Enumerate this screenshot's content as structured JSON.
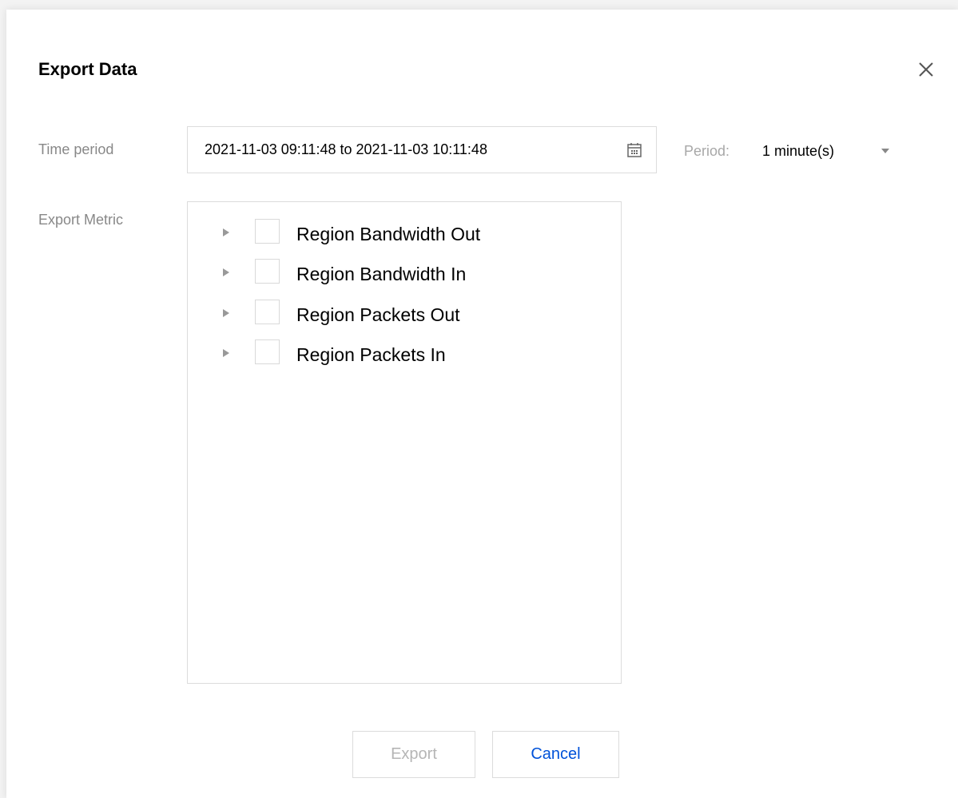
{
  "dialog": {
    "title": "Export Data",
    "close_icon": "close-icon"
  },
  "time_period": {
    "label": "Time period",
    "value": "2021-11-03 09:11:48 to 2021-11-03 10:11:48",
    "icon": "calendar-icon"
  },
  "period": {
    "label": "Period:",
    "selected": "1 minute(s)",
    "icon": "caret-down-icon"
  },
  "export_metric": {
    "label": "Export Metric",
    "items": [
      {
        "label": "Region Bandwidth Out",
        "checked": false,
        "expanded": false
      },
      {
        "label": "Region Bandwidth In",
        "checked": false,
        "expanded": false
      },
      {
        "label": "Region Packets Out",
        "checked": false,
        "expanded": false
      },
      {
        "label": "Region Packets In",
        "checked": false,
        "expanded": false
      }
    ]
  },
  "footer": {
    "export_label": "Export",
    "export_disabled": true,
    "cancel_label": "Cancel"
  },
  "colors": {
    "primary": "#0052d9",
    "label_gray": "#888888",
    "disabled_text": "#b5b5b5",
    "border": "#dcdcdc"
  }
}
